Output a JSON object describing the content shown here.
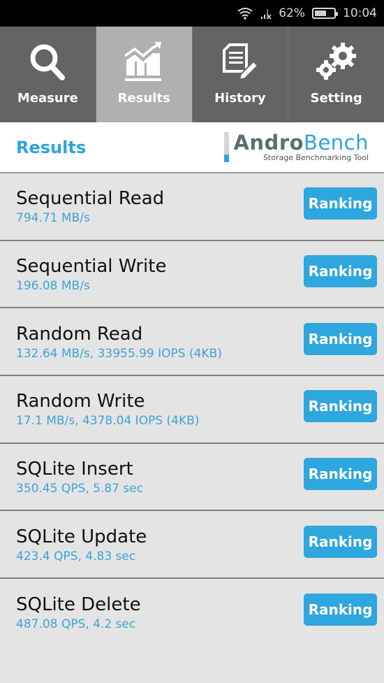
{
  "status_bar": {
    "wifi_icon": "wifi-icon",
    "signal_icon": "signal-icon",
    "battery_percent": "62%",
    "battery_level": 0.62,
    "time": "10:04"
  },
  "tabs": [
    {
      "label": "Measure",
      "icon": "search-icon",
      "active": false
    },
    {
      "label": "Results",
      "icon": "chart-icon",
      "active": true
    },
    {
      "label": "History",
      "icon": "document-edit-icon",
      "active": false
    },
    {
      "label": "Setting",
      "icon": "gears-icon",
      "active": false
    }
  ],
  "header": {
    "title": "Results",
    "logo_name_part1": "Andro",
    "logo_name_part2": "Bench",
    "logo_subtitle": "Storage Benchmarking Tool"
  },
  "results": [
    {
      "name": "Sequential Read",
      "value": "794.71 MB/s",
      "button": "Ranking"
    },
    {
      "name": "Sequential Write",
      "value": "196.08 MB/s",
      "button": "Ranking"
    },
    {
      "name": "Random Read",
      "value": "132.64 MB/s, 33955.99 IOPS (4KB)",
      "button": "Ranking"
    },
    {
      "name": "Random Write",
      "value": "17.1 MB/s, 4378.04 IOPS (4KB)",
      "button": "Ranking"
    },
    {
      "name": "SQLite Insert",
      "value": "350.45 QPS, 5.87 sec",
      "button": "Ranking"
    },
    {
      "name": "SQLite Update",
      "value": "423.4 QPS, 4.83 sec",
      "button": "Ranking"
    },
    {
      "name": "SQLite Delete",
      "value": "487.08 QPS, 4.2 sec",
      "button": "Ranking"
    }
  ],
  "colors": {
    "accent": "#2ea3db",
    "tab_bg": "#646464",
    "tab_active_bg": "#b0b0b0",
    "list_bg": "#e4e4e4"
  }
}
